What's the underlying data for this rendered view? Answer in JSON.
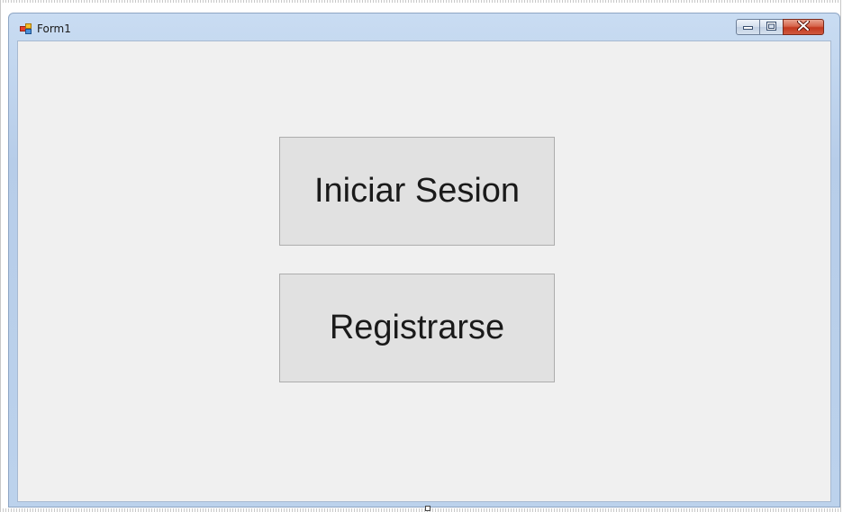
{
  "window": {
    "title": "Form1",
    "icon": "form-icon",
    "caption_buttons": [
      "minimize-icon",
      "maximize-icon",
      "close-icon"
    ]
  },
  "form": {
    "login_button_label": "Iniciar Sesion",
    "register_button_label": "Registrarse"
  },
  "colors": {
    "client_background": "#f0f0f0",
    "button_face": "#e1e1e1",
    "button_border": "#adadad",
    "close_button": "#c2381e"
  }
}
